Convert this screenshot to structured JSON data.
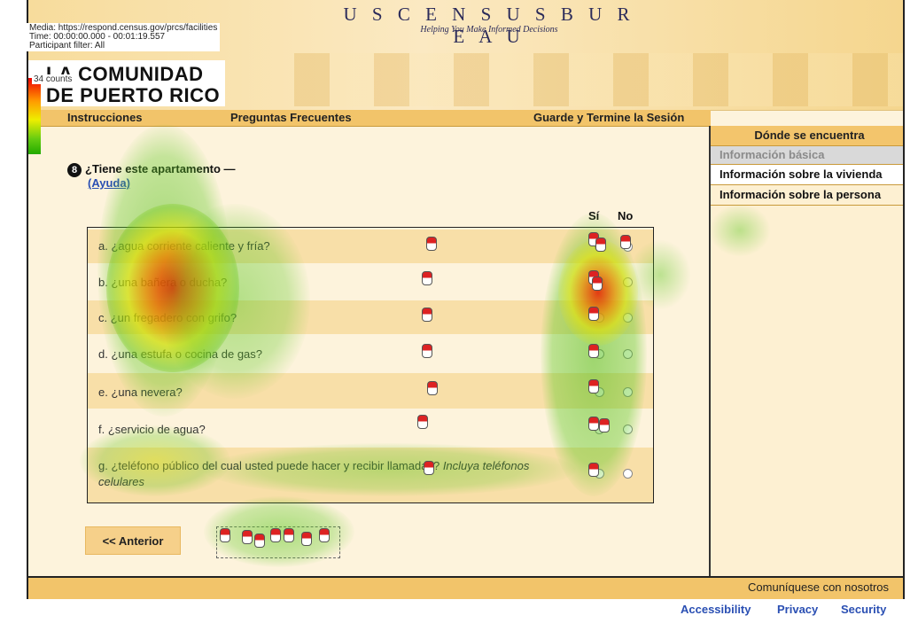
{
  "overlay": {
    "media": "Media: https://respond.census.gov/prcs/facilities",
    "time": "Time: 00:00:00.000 - 00:01:19.557",
    "filter": "Participant filter: All",
    "legend_label": "34 counts"
  },
  "header": {
    "agency": "U S C E N S U S B U R E A U",
    "tagline": "Helping You Make Informed Decisions",
    "community_line1": "LA COMUNIDAD",
    "community_line2": "DE PUERTO RICO"
  },
  "nav": {
    "instrucciones": "Instrucciones",
    "preguntas": "Preguntas Frecuentes",
    "guarde": "Guarde y Termine la Sesión"
  },
  "sidebar": {
    "title": "Dónde se encuentra",
    "items": [
      {
        "label": "Información básica",
        "state": "done"
      },
      {
        "label": "Información sobre la vivienda",
        "state": "current"
      },
      {
        "label": "Información sobre la persona",
        "state": "todo"
      }
    ]
  },
  "question": {
    "number": "8",
    "text": "¿Tiene este apartamento —",
    "help": "(Ayuda)",
    "col_si": "Sí",
    "col_no": "No"
  },
  "rows": [
    {
      "label": "a. ¿agua corriente caliente y fría?"
    },
    {
      "label": "b. ¿una bañera o ducha?"
    },
    {
      "label": "c. ¿un fregadero con grifo?"
    },
    {
      "label": "d. ¿una estufa o cocina de gas?"
    },
    {
      "label": "e. ¿una nevera?"
    },
    {
      "label": "f. ¿servicio de agua?"
    },
    {
      "label": "g. ¿teléfono público del cual usted puede hacer y recibir llamadas?",
      "note": "Incluya teléfonos celulares"
    }
  ],
  "buttons": {
    "anterior": "<<  Anterior"
  },
  "footer": {
    "contact": "Comuníquese con nosotros",
    "accessibility": "Accessibility",
    "privacy": "Privacy",
    "security": "Security"
  },
  "colors": {
    "gold": "#f2c46a",
    "link": "#2a4fb3",
    "heat_hot": "#e00000",
    "heat_cool": "#2aa000"
  }
}
